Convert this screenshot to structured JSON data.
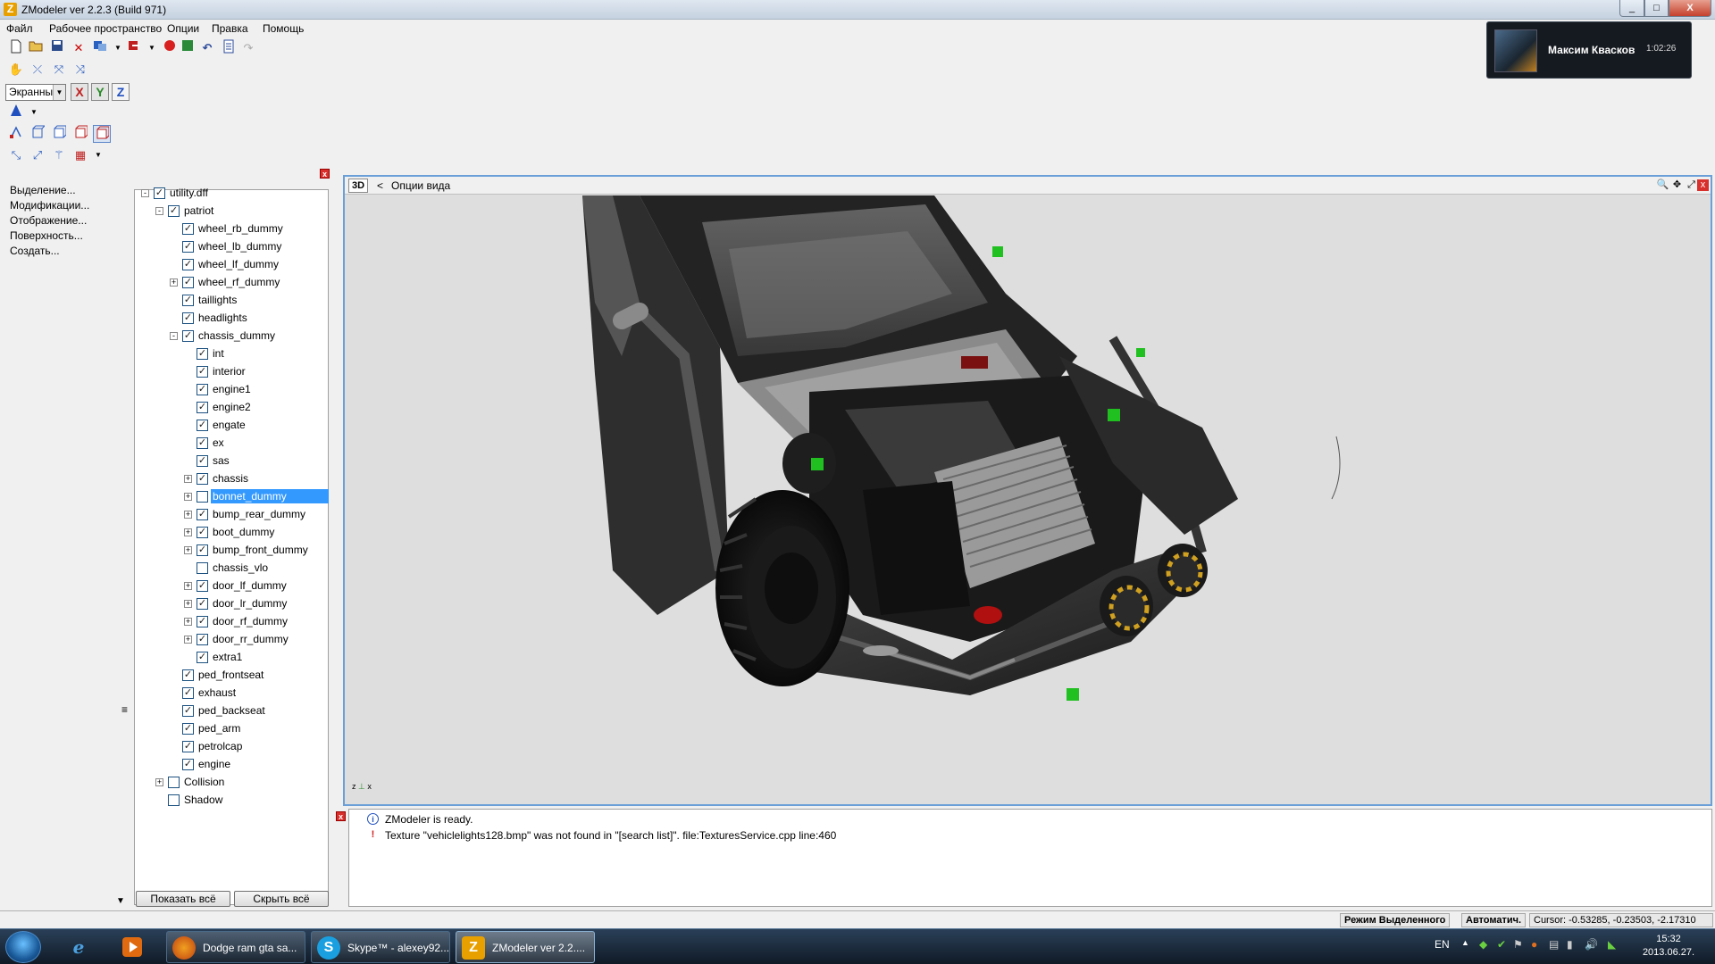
{
  "window": {
    "title": "ZModeler ver 2.2.3 (Build 971)",
    "minimize": "_",
    "maximize": "□",
    "close": "X"
  },
  "menu": [
    "Файл",
    "Рабочее пространство",
    "Опции",
    "Правка",
    "Помощь"
  ],
  "toolbar": {
    "view_combo": "Экранны",
    "axis_x": "X",
    "axis_y": "Y",
    "axis_z": "Z"
  },
  "notification": {
    "name": "Максим Квасков",
    "time": "1:02:26"
  },
  "command_panel": {
    "items": [
      "Выделение...",
      "Модификации...",
      "Отображение...",
      "Поверхность...",
      "Создать..."
    ]
  },
  "tree": {
    "nodes": [
      {
        "label": "utility.dff",
        "checked": true,
        "expander": "-"
      },
      {
        "label": "patriot",
        "checked": true,
        "expander": "-"
      },
      {
        "label": "wheel_rb_dummy",
        "checked": true,
        "expander": ""
      },
      {
        "label": "wheel_lb_dummy",
        "checked": true,
        "expander": ""
      },
      {
        "label": "wheel_lf_dummy",
        "checked": true,
        "expander": ""
      },
      {
        "label": "wheel_rf_dummy",
        "checked": true,
        "expander": "+"
      },
      {
        "label": "taillights",
        "checked": true,
        "expander": ""
      },
      {
        "label": "headlights",
        "checked": true,
        "expander": ""
      },
      {
        "label": "chassis_dummy",
        "checked": true,
        "expander": "-"
      },
      {
        "label": "int",
        "checked": true,
        "expander": ""
      },
      {
        "label": "interior",
        "checked": true,
        "expander": ""
      },
      {
        "label": "engine1",
        "checked": true,
        "expander": ""
      },
      {
        "label": "engine2",
        "checked": true,
        "expander": ""
      },
      {
        "label": "engate",
        "checked": true,
        "expander": ""
      },
      {
        "label": "ex",
        "checked": true,
        "expander": ""
      },
      {
        "label": "sas",
        "checked": true,
        "expander": ""
      },
      {
        "label": "chassis",
        "checked": true,
        "expander": "+"
      },
      {
        "label": "bonnet_dummy",
        "checked": false,
        "expander": "+",
        "selected": true
      },
      {
        "label": "bump_rear_dummy",
        "checked": true,
        "expander": "+"
      },
      {
        "label": "boot_dummy",
        "checked": true,
        "expander": "+"
      },
      {
        "label": "bump_front_dummy",
        "checked": true,
        "expander": "+"
      },
      {
        "label": "chassis_vlo",
        "checked": false,
        "expander": ""
      },
      {
        "label": "door_lf_dummy",
        "checked": true,
        "expander": "+"
      },
      {
        "label": "door_lr_dummy",
        "checked": true,
        "expander": "+"
      },
      {
        "label": "door_rf_dummy",
        "checked": true,
        "expander": "+"
      },
      {
        "label": "door_rr_dummy",
        "checked": true,
        "expander": "+"
      },
      {
        "label": "extra1",
        "checked": true,
        "expander": ""
      },
      {
        "label": "ped_frontseat",
        "checked": true,
        "expander": ""
      },
      {
        "label": "exhaust",
        "checked": true,
        "expander": ""
      },
      {
        "label": "ped_backseat",
        "checked": true,
        "expander": ""
      },
      {
        "label": "ped_arm",
        "checked": true,
        "expander": ""
      },
      {
        "label": "petrolcap",
        "checked": true,
        "expander": ""
      },
      {
        "label": "engine",
        "checked": true,
        "expander": ""
      },
      {
        "label": "Collision",
        "checked": false,
        "expander": "+"
      },
      {
        "label": "Shadow",
        "checked": false,
        "expander": ""
      }
    ],
    "show_all": "Показать всё",
    "hide_all": "Скрыть всё"
  },
  "viewport": {
    "mode_label": "3D",
    "options_label": "Опции вида",
    "nav": "<",
    "axis_z": "z",
    "axis_x": "x"
  },
  "log": [
    {
      "type": "info",
      "text": "ZModeler is ready."
    },
    {
      "type": "warning",
      "text": "Texture \"vehiclelights128.bmp\" was not found in \"[search list]\". file:TexturesService.cpp line:460"
    }
  ],
  "status": {
    "mode": "Режим Выделенного",
    "auto": "Автоматич.",
    "cursor": "Cursor: -0.53285, -0.23503, -2.17310"
  },
  "taskbar": {
    "tasks": [
      {
        "label": "Dodge ram gta sa...",
        "icon": "firefox-icon"
      },
      {
        "label": "Skype™ - alexey92...",
        "icon": "skype-icon"
      },
      {
        "label": "ZModeler ver 2.2....",
        "icon": "zmodeler-icon"
      }
    ],
    "lang": "EN",
    "time": "15:32",
    "date": "2013.06.27."
  },
  "colors": {
    "accent": "#3399ff",
    "viewport_border": "#6a9fd8",
    "taskbar": "#1a2a3c"
  }
}
